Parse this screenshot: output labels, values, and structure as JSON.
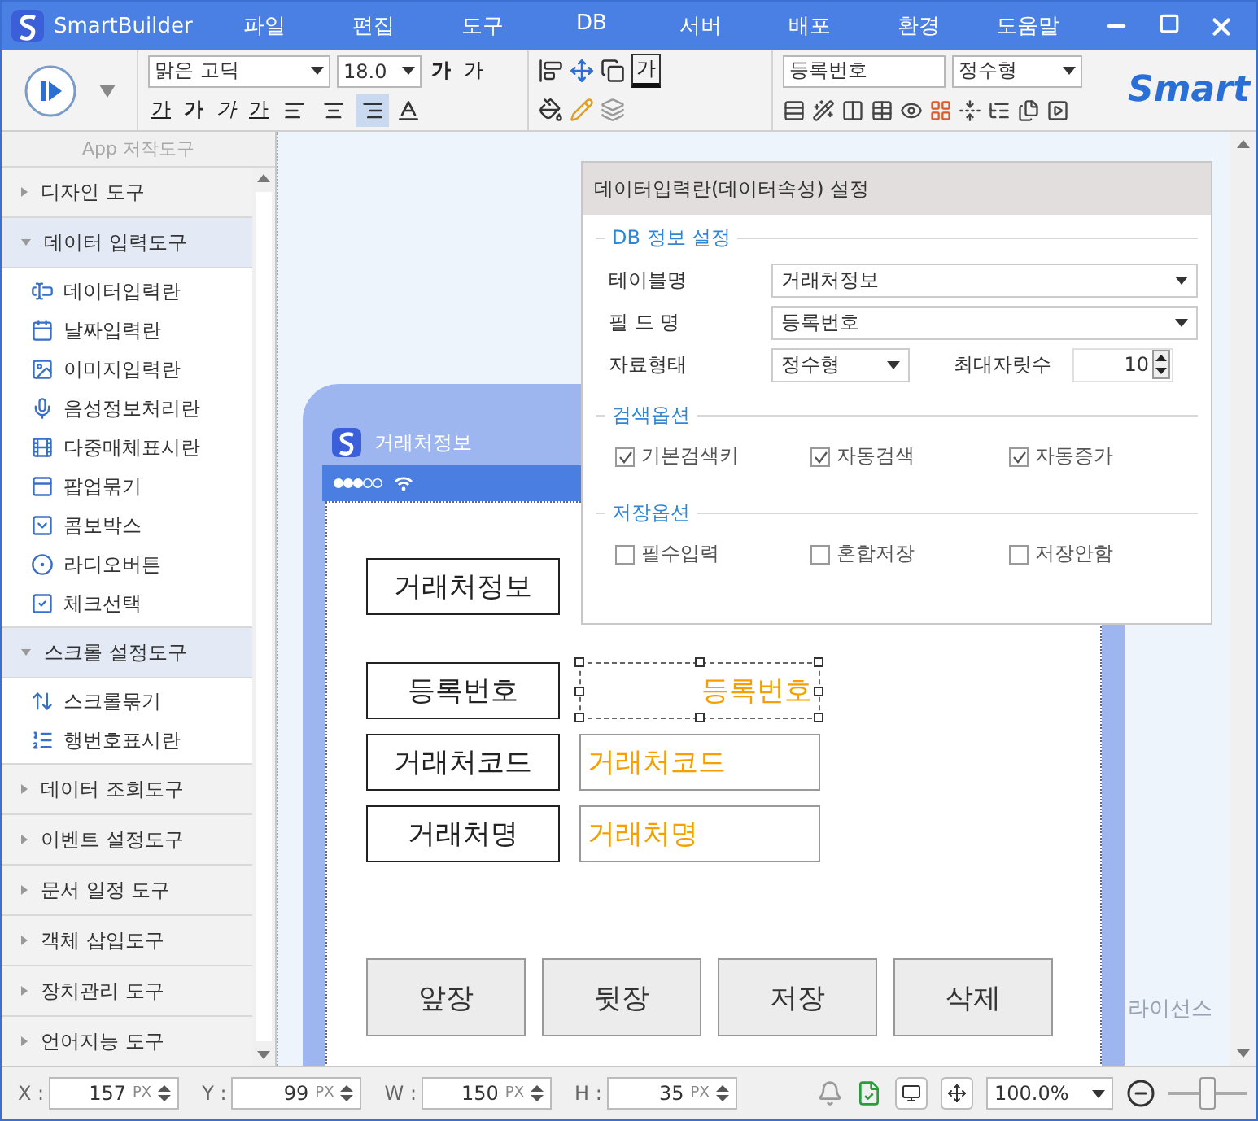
{
  "window": {
    "title": "SmartBuilder",
    "menu": [
      "파일",
      "편집",
      "도구",
      "DB",
      "서버",
      "배포",
      "환경",
      "도움말"
    ]
  },
  "toolbar": {
    "font_name": "맑은 고딕",
    "font_size": "18.0",
    "grow_glyph": "가",
    "shrink_glyph": "가",
    "color_glyph": "가",
    "style_glyphs": [
      "가",
      "가",
      "가"
    ],
    "align_buttons": [
      {
        "selected": false
      },
      {
        "selected": false
      },
      {
        "selected": true
      }
    ],
    "fill_glyph": "가",
    "field_name": "등록번호",
    "field_type": "정수형",
    "logo": "Smart"
  },
  "sidebar": {
    "title": "App 저작도구",
    "groups": [
      {
        "label": "디자인 도구",
        "expanded": false
      },
      {
        "label": "데이터 입력도구",
        "expanded": true,
        "children": [
          {
            "label": "데이터입력란"
          },
          {
            "label": "날짜입력란"
          },
          {
            "label": "이미지입력란"
          },
          {
            "label": "음성정보처리란"
          },
          {
            "label": "다중매체표시란"
          },
          {
            "label": "팝업묶기"
          },
          {
            "label": "콤보박스"
          },
          {
            "label": "라디오버튼"
          },
          {
            "label": "체크선택"
          }
        ]
      },
      {
        "label": "스크롤 설정도구",
        "expanded": true,
        "children": [
          {
            "label": "스크롤묶기"
          },
          {
            "label": "행번호표시란"
          }
        ]
      },
      {
        "label": "데이터 조회도구",
        "expanded": false
      },
      {
        "label": "이벤트 설정도구",
        "expanded": false
      },
      {
        "label": "문서 일정 도구",
        "expanded": false
      },
      {
        "label": "객체 삽입도구",
        "expanded": false
      },
      {
        "label": "장치관리 도구",
        "expanded": false
      },
      {
        "label": "언어지능 도구",
        "expanded": false
      }
    ]
  },
  "canvas": {
    "screen_title": "거래처정보",
    "heading": "거래처정보",
    "fields": [
      {
        "label": "등록번호",
        "value": "등록번호",
        "selected": true
      },
      {
        "label": "거래처코드",
        "value": "거래처코드",
        "selected": false
      },
      {
        "label": "거래처명",
        "value": "거래처명",
        "selected": false
      }
    ],
    "buttons": [
      "앞장",
      "뒷장",
      "저장",
      "삭제"
    ],
    "license": "라이선스"
  },
  "dialog": {
    "title": "데이터입력란(데이터속성) 설정",
    "db_section": {
      "title": "DB 정보 설정",
      "table_label": "테이블명",
      "table_value": "거래처정보",
      "field_label": "필 드 명",
      "field_value": "등록번호",
      "type_label": "자료형태",
      "type_value": "정수형",
      "digits_label": "최대자릿수",
      "digits_value": "10"
    },
    "option_sections": [
      {
        "title": "검색옵션",
        "options": [
          {
            "label": "기본검색키",
            "checked": true
          },
          {
            "label": "자동검색",
            "checked": true
          },
          {
            "label": "자동증가",
            "checked": true
          }
        ]
      },
      {
        "title": "저장옵션",
        "options": [
          {
            "label": "필수입력",
            "checked": false
          },
          {
            "label": "혼합저장",
            "checked": false
          },
          {
            "label": "저장안함",
            "checked": false
          }
        ]
      }
    ]
  },
  "status_bar": {
    "fields": [
      {
        "label": "X :",
        "value": "157",
        "unit": "PX"
      },
      {
        "label": "Y :",
        "value": "99",
        "unit": "PX"
      },
      {
        "label": "W :",
        "value": "150",
        "unit": "PX"
      },
      {
        "label": "H :",
        "value": "35",
        "unit": "PX"
      }
    ],
    "zoom": "100.0%",
    "zoom_slider": {
      "level": 0.5
    }
  }
}
